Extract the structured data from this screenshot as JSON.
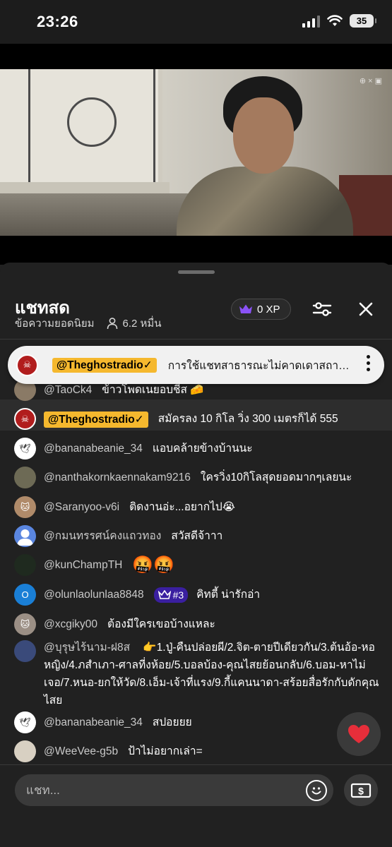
{
  "status_bar": {
    "time": "23:26",
    "battery": "35"
  },
  "video": {
    "watermark": "⊕ × ▣"
  },
  "chat_header": {
    "title": "แชทสด",
    "subtitle": "ข้อความยอดนิยม",
    "viewers": "6.2 หมื่น",
    "xp": "0 XP"
  },
  "pinned": {
    "author": "@Theghostradio✓",
    "text": "การใช้แชทสาธารณะไม่คาดเดาสถานที่..."
  },
  "messages": [
    {
      "author": "@TaoCk4",
      "text": "ข้าวโพดเนยอบชีส 🧀",
      "avatar_color": "#8a7a66",
      "avatar_glyph": "",
      "owner": false
    },
    {
      "author": "@Theghostradio✓",
      "text": "สมัครลง 10 กิโล วิ่ง 300 เมตรก็ได้ 555",
      "avatar_color": "#b11d1d",
      "avatar_glyph": "☠",
      "owner": true
    },
    {
      "author": "@bananabeanie_34",
      "text": "แอบคล้ายข้างบ้านนะ",
      "avatar_color": "#ffffff",
      "avatar_glyph": "🕊",
      "owner": false
    },
    {
      "author": "@nanthakornkaennakam9216",
      "text": "ใครวิ่ง10กิโลสุดยอดมากๆเลยนะ",
      "avatar_color": "#6d6a55",
      "avatar_glyph": "",
      "owner": false
    },
    {
      "author": "@Saranyoo-v6i",
      "text": "ติดงานอ่ะ...อยากไป😭",
      "avatar_color": "#b08b6a",
      "avatar_glyph": "🐱",
      "owner": false
    },
    {
      "author": "@กมนทรรศน์คงแถวทอง",
      "text": "สวัสดีจ้าาา",
      "avatar_color": "#5a86e0",
      "avatar_glyph": "👤",
      "owner": false
    },
    {
      "author": "@kunChampTH",
      "text": "🤬🤬",
      "avatar_color": "#1f2a1f",
      "avatar_glyph": "",
      "owner": false
    },
    {
      "author": "@olunlaolunlaa8848",
      "text": "คิทตี้ น่ารักอ่า",
      "avatar_color": "#1a7fd6",
      "avatar_glyph": "O",
      "owner": false,
      "badge": "#3"
    },
    {
      "author": "@xcgiky00",
      "text": "ต้องมีใครเขอบ้างแหละ",
      "avatar_color": "#9b8f85",
      "avatar_glyph": "🐱",
      "owner": false
    },
    {
      "author": "@บุรุษไร้นาม-ฝ8ส",
      "text": "👉1.ปู่-คืนปล่อยผี/2.จิต-ตายปีเดียวกัน/3.ต้นอ้อ-หอหญิง/4.ภสำเภา-ศาลที่งห้อย/5.บอลบ้อง-คุณไสยย้อนกลับ/6.บอม-หาไม่เจอ/7.หนอ-ยกให้วัด/8.เอ็ม-เจ้าที่แรง/9.กี้แคนนาดา-สร้อยสื่อรักกับดักคุณไสย",
      "avatar_color": "#3a4a7a",
      "avatar_glyph": "",
      "owner": false
    },
    {
      "author": "@bananabeanie_34",
      "text": "สปอยยย",
      "avatar_color": "#ffffff",
      "avatar_glyph": "🕊",
      "owner": false
    },
    {
      "author": "@WeeVee-g5b",
      "text": "ป้าไม่อยากเล่า=",
      "avatar_color": "#d8d0c2",
      "avatar_glyph": "",
      "owner": false
    }
  ],
  "input": {
    "placeholder": "แชท..."
  },
  "colors": {
    "owner_badge": "#f5b82e",
    "member_badge": "#3a1fa0",
    "heart": "#e62e3a"
  },
  "icons": [
    "signal-icon",
    "wifi-icon",
    "battery-icon",
    "crown-icon",
    "person-icon",
    "settings-sliders-icon",
    "close-icon",
    "kebab-menu-icon",
    "heart-icon",
    "emoji-icon",
    "superchat-icon"
  ]
}
